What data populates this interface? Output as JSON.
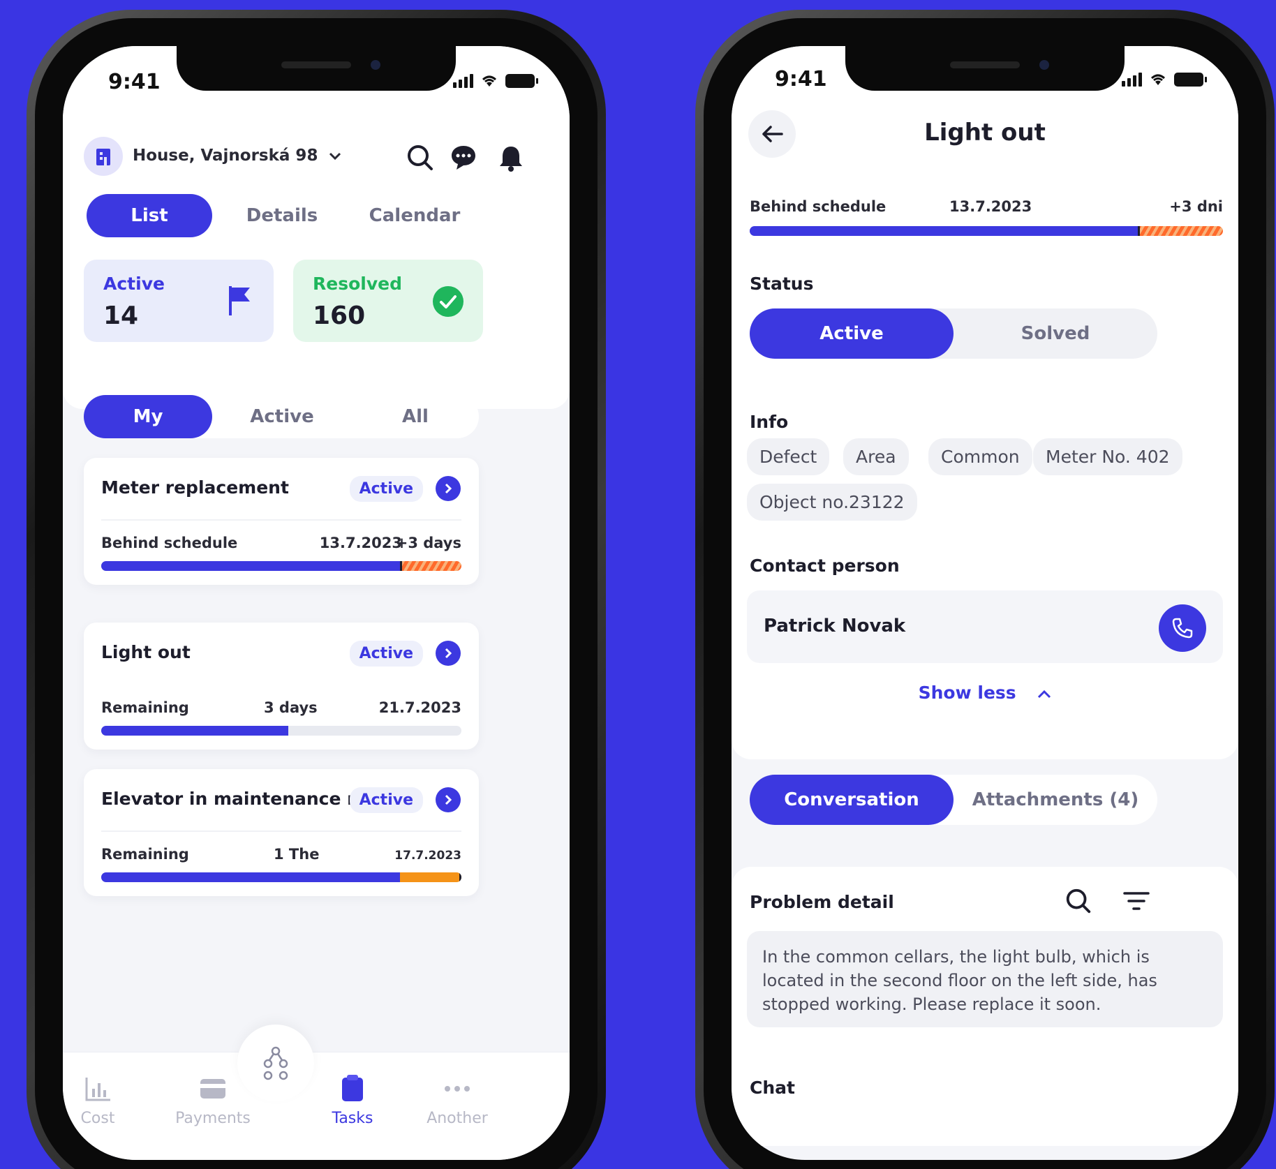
{
  "left_phone": {
    "status_time": "9:41",
    "address": "House, Vajnorská 98",
    "view_tabs": [
      "List",
      "Details",
      "Calendar"
    ],
    "active_view_tab": "List",
    "stats": {
      "active": {
        "label": "Active",
        "value": "14"
      },
      "resolved": {
        "label": "Resolved",
        "value": "160"
      }
    },
    "filter_tabs": [
      "My",
      "Active",
      "All"
    ],
    "active_filter": "My",
    "tasks": [
      {
        "title": "Meter replacement",
        "badge": "Active",
        "left": "Behind schedule",
        "middle": "13.7.2023",
        "right": "+3 days",
        "progress": 0.83,
        "overdue": 0.17
      },
      {
        "title": "Light out",
        "badge": "Active",
        "left": "Remaining",
        "middle": "3 days",
        "right": "21.7.2023",
        "progress": 0.52,
        "overdue": 0
      },
      {
        "title": "Elevator in maintenance mode",
        "badge": "Active",
        "left": "Remaining",
        "middle": "1 The",
        "right": "17.7.2023",
        "progress": 0.83,
        "overdue": 0.17
      }
    ],
    "tabbar": [
      "Cost",
      "Payments",
      "Tasks",
      "Another"
    ],
    "active_tab": "Tasks"
  },
  "right_phone": {
    "status_time": "9:41",
    "title": "Light out",
    "schedule": {
      "left": "Behind schedule",
      "middle": "13.7.2023",
      "right": "+3 dni",
      "progress": 0.82,
      "overdue": 0.18
    },
    "status_label": "Status",
    "status_options": [
      "Active",
      "Solved"
    ],
    "info_label": "Info",
    "info_chips": [
      "Defect",
      "Area",
      "Common",
      "Meter No. 402",
      "Object no.23122"
    ],
    "contact_label": "Contact person",
    "contact_name": "Patrick Novak",
    "show_less": "Show less",
    "tabs": [
      "Conversation",
      "Attachments (4)"
    ],
    "problem_label": "Problem detail",
    "problem_text": "In the common cellars, the light bulb, which is located in the second floor on the left side, has stopped working. Please replace it soon.",
    "chat_label": "Chat"
  },
  "colors": {
    "accent": "#3c38e0",
    "background": "#3a35e3",
    "success": "#1fb65c",
    "overdue": "#ff6a2b"
  }
}
